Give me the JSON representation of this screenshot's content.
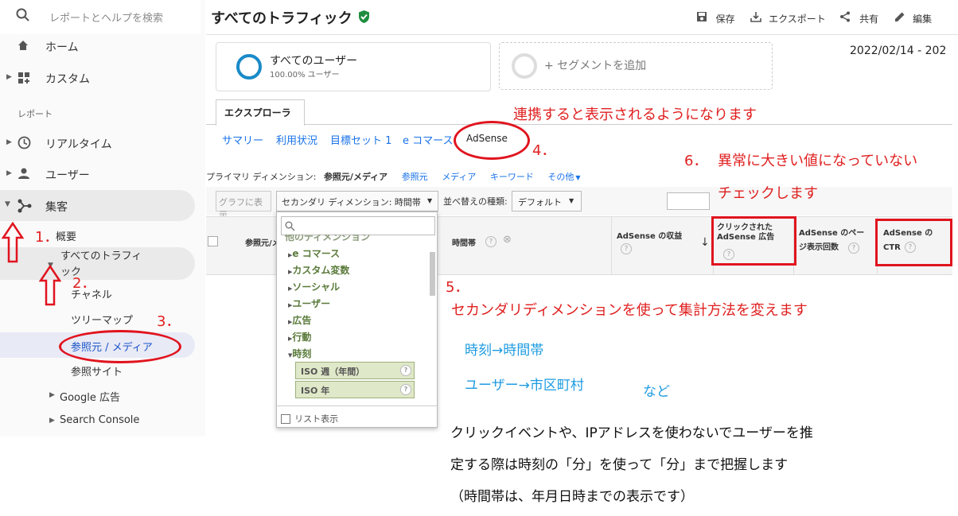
{
  "sidebar": {
    "search_placeholder": "レポートとヘルプを検索",
    "home": "ホーム",
    "custom": "カスタム",
    "section_report": "レポート",
    "realtime": "リアルタイム",
    "users": "ユーザー",
    "acquisition": "集客",
    "overview": "概要",
    "all_traffic": "すべてのトラフィック",
    "channels": "チャネル",
    "treemap": "ツリーマップ",
    "source_medium": "参照元 / メディア",
    "referrals": "参照サイト",
    "google_ads": "Google 広告",
    "search_console": "Search Console"
  },
  "header": {
    "title": "すべてのトラフィック",
    "save": "保存",
    "export": "エクスポート",
    "share": "共有",
    "edit": "編集",
    "date_range": "2022/02/14 - 202"
  },
  "segment": {
    "name": "すべてのユーザー",
    "percent": "100.00% ユーザー",
    "add": "+ セグメントを追加"
  },
  "explorer": {
    "tab": "エクスプローラ",
    "subtabs": [
      "サマリー",
      "利用状況",
      "目標セット 1",
      "e コマース",
      "AdSense"
    ]
  },
  "primary": {
    "label": "プライマリ ディメンション:",
    "current": "参照元/メディア",
    "links": [
      "参照元",
      "メディア",
      "キーワード",
      "その他"
    ]
  },
  "controls": {
    "graph_btn": "グラフに表示",
    "secondary_dim": "セカンダリ ディメンション: 時間帯",
    "sort_label": "並べ替えの種類:",
    "sort_value": "デフォルト"
  },
  "table": {
    "col_source": "参照元/メ",
    "col_hour": "時間帯",
    "col_revenue": "AdSense の収益",
    "col_clicked": "クリックされた AdSense 広告",
    "col_pageviews": "AdSense のページ表示回数",
    "col_ctr": "AdSense の CTR"
  },
  "dropdown": {
    "search_placeholder": "",
    "partial": "他のディメンション",
    "items": [
      "e コマース",
      "カスタム変数",
      "ソーシャル",
      "ユーザー",
      "広告",
      "行動",
      "時刻"
    ],
    "leaves": [
      "ISO 週（年間）",
      "ISO 年"
    ],
    "list_view": "リスト表示"
  },
  "annotations": {
    "n1": "1．",
    "n2": "2．",
    "n3": "3．",
    "n4": "4．",
    "n5": "5．",
    "n6": "6．",
    "linked_note": "連携すると表示されるようになります",
    "abnormal_1": "異常に大きい値になっていない",
    "abnormal_2": "チェックします",
    "secondary_note": "セカンダリディメンションを使って集計方法を変えます",
    "ex1": "時刻→時間帯",
    "ex2": "ユーザー→市区町村",
    "etc": "など",
    "body_1": "クリックイベントや、IPアドレスを使わないでユーザーを推",
    "body_2": "定する際は時刻の「分」を使って「分」まで把握します",
    "body_3": "（時間帯は、年月日時までの表示です）"
  },
  "colors": {
    "accent": "#1a73e8",
    "annotation_red": "#e0141e",
    "annotation_blue": "#1e9be0",
    "segment_ring": "#1a8ac8"
  }
}
